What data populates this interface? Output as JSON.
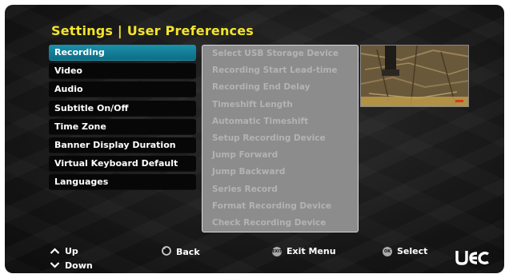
{
  "header": {
    "title": "Settings | User Preferences"
  },
  "menu": {
    "selected_index": 0,
    "items": [
      {
        "label": "Recording"
      },
      {
        "label": "Video"
      },
      {
        "label": "Audio"
      },
      {
        "label": "Subtitle On/Off"
      },
      {
        "label": "Time Zone"
      },
      {
        "label": "Banner Display Duration"
      },
      {
        "label": "Virtual Keyboard Default"
      },
      {
        "label": "Languages"
      }
    ]
  },
  "submenu": {
    "items": [
      {
        "label": "Select USB Storage Device"
      },
      {
        "label": "Recording Start Lead-time"
      },
      {
        "label": "Recording End Delay"
      },
      {
        "label": "Timeshift Length"
      },
      {
        "label": "Automatic Timeshift"
      },
      {
        "label": "Setup Recording Device"
      },
      {
        "label": "Jump Forward"
      },
      {
        "label": "Jump Backward"
      },
      {
        "label": "Series Record"
      },
      {
        "label": "Format Recording Device"
      },
      {
        "label": "Check Recording Device"
      }
    ]
  },
  "footer": {
    "up_label": "Up",
    "down_label": "Down",
    "back_label": "Back",
    "exit_label": "Exit Menu",
    "exit_icon_text": "EXIT",
    "select_label": "Select",
    "ok_icon_text": "OK",
    "logo_text": "UEC"
  },
  "colors": {
    "title": "#f3e42c",
    "selected": "#137f99",
    "submenu_bg": "#8c8c8c"
  }
}
